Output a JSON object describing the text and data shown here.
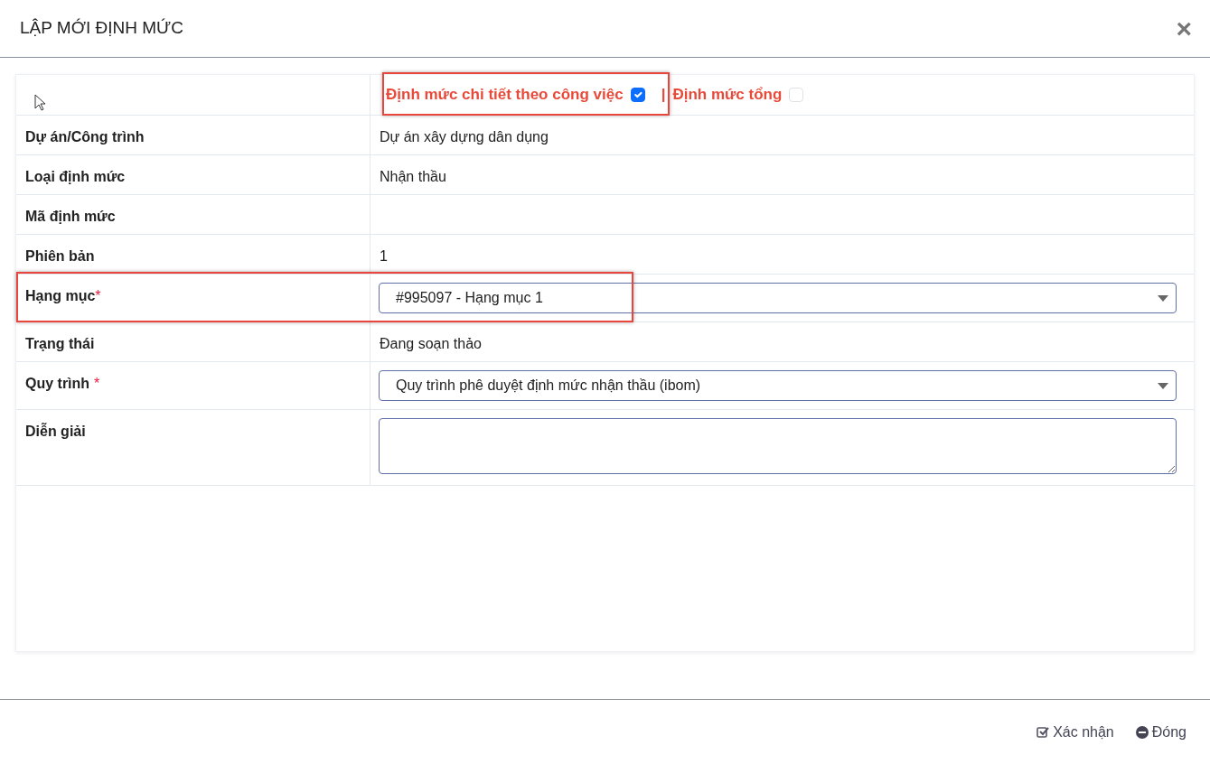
{
  "dialog": {
    "title": "LẬP MỚI ĐỊNH MỨC",
    "close": "×"
  },
  "modes": [
    {
      "label": "Định mức chi tiết theo công việc",
      "checked": true
    },
    {
      "label": "Định mức tổng",
      "checked": false,
      "separator": "|"
    }
  ],
  "fields": [
    {
      "kind": "text",
      "label": "Dự án/Công trình",
      "value": "Dự án xây dựng dân dụng"
    },
    {
      "kind": "text",
      "label": "Loại định mức",
      "value": "Nhận thầu"
    },
    {
      "kind": "text",
      "label": "Mã định mức"
    },
    {
      "kind": "text",
      "label": "Phiên bản",
      "value": "1"
    },
    {
      "kind": "select",
      "label": "Hạng mục",
      "required_mark": "*",
      "mark_spaced": false,
      "value": "#995097 - Hạng mục 1"
    },
    {
      "kind": "text",
      "label": "Trạng thái",
      "value": "Đang soạn thảo"
    },
    {
      "kind": "select",
      "label": "Quy trình",
      "required_mark": "*",
      "mark_spaced": true,
      "value": "Quy trình phê duyệt định mức nhận thầu (ibom)"
    },
    {
      "kind": "textarea",
      "label": "Diễn giải"
    }
  ],
  "footer_buttons": [
    {
      "kind": "confirm",
      "label": "Xác nhận"
    },
    {
      "kind": "close",
      "label": "Đóng"
    }
  ]
}
